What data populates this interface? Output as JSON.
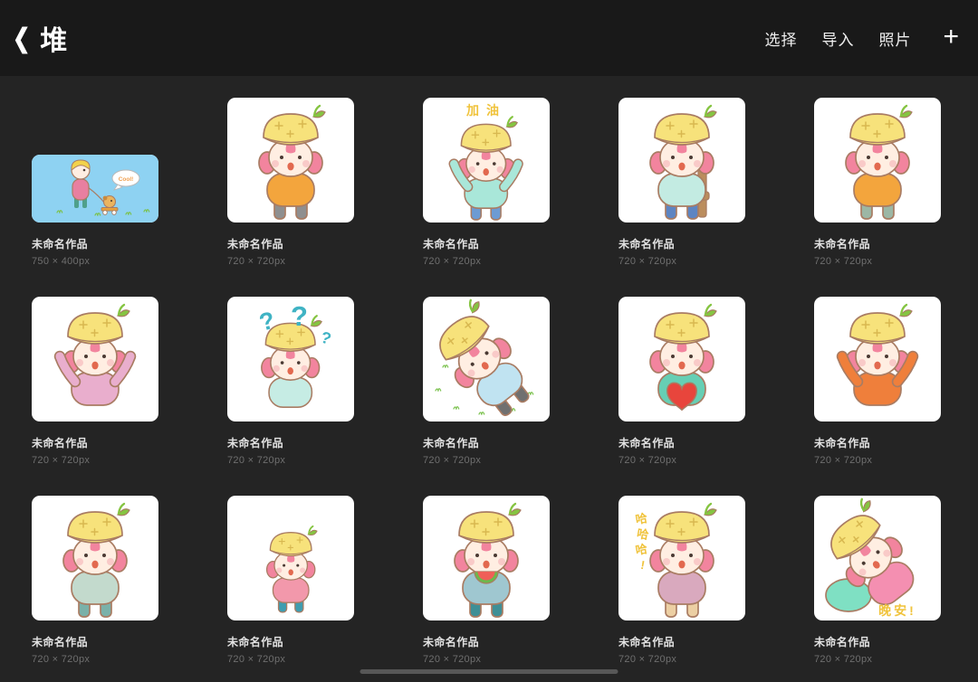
{
  "header": {
    "back_chevron": "❮",
    "title": "堆",
    "actions": [
      "选择",
      "导入",
      "照片"
    ],
    "add_label": "+"
  },
  "palette": {
    "hat": "#f7e27b",
    "hat_marks": "#d8b850",
    "leaf": "#85c441",
    "hair": "#f2849e",
    "skin": "#ffeee2",
    "outline": "#a97c63",
    "blush": "#f8c3c3",
    "mouth": "#e2694f",
    "accent_yellow": "#f0c33c",
    "qmark": "#3fb3c4",
    "heart_red": "#e8453c",
    "grass": "#7cc24f"
  },
  "artworks": [
    {
      "title": "未命名作品",
      "size": "750 × 400px",
      "type": "wide",
      "desc": "girl with yellow hair walking a puppy on a cart, blue sky background",
      "art": {
        "bg": "#8ed2f2",
        "bubble_text": "Cool!"
      }
    },
    {
      "title": "未命名作品",
      "size": "720 × 720px",
      "type": "square",
      "desc": "pineapple-hat girl with arms crossed, pouting",
      "art": {
        "pose": "stand",
        "shirt": "#f3a53d",
        "pants": "#8f8f8f"
      }
    },
    {
      "title": "未命名作品",
      "size": "720 × 720px",
      "type": "square",
      "desc": "cheering with both arms raised",
      "art": {
        "pose": "arms-up",
        "shirt": "#a9e7d9",
        "pants": "#6d9bd3",
        "accent_text": "加油",
        "accent_pos": "top"
      }
    },
    {
      "title": "未命名作品",
      "size": "720 × 720px",
      "type": "square",
      "desc": "sitting on a wooden chair in blue overalls",
      "art": {
        "pose": "stand",
        "shirt": "#c3ebe2",
        "pants": "#5d85c2",
        "chair": true
      }
    },
    {
      "title": "未命名作品",
      "size": "720 × 720px",
      "type": "square",
      "desc": "laughing loudly with head tilted back",
      "art": {
        "pose": "stand",
        "shirt": "#f3a53d",
        "pants": "#9cb7a5"
      }
    },
    {
      "title": "未命名作品",
      "size": "720 × 720px",
      "type": "square",
      "desc": "hands on head, upset, pink sweater",
      "art": {
        "pose": "arms-up",
        "shirt": "#e9aecd",
        "pants": ""
      }
    },
    {
      "title": "未命名作品",
      "size": "720 × 720px",
      "type": "square",
      "desc": "confused with teal question marks above head",
      "art": {
        "pose": "stand",
        "shirt": "#c6ece4",
        "pants": "",
        "accessory": "qmarks"
      }
    },
    {
      "title": "未命名作品",
      "size": "720 × 720px",
      "type": "square",
      "desc": "lying on the grass relaxing",
      "art": {
        "pose": "lying",
        "shirt": "#c0e3f1",
        "pants": "#707070",
        "grass": true
      }
    },
    {
      "title": "未命名作品",
      "size": "720 × 720px",
      "type": "square",
      "desc": "hugging a big red heart, teal sweater",
      "art": {
        "pose": "stand",
        "shirt": "#66cfb4",
        "pants": "",
        "accessory": "heart"
      }
    },
    {
      "title": "未命名作品",
      "size": "720 × 720px",
      "type": "square",
      "desc": "waving hello in orange apron dress",
      "art": {
        "pose": "arms-up",
        "shirt": "#ef7f3b",
        "pants": ""
      }
    },
    {
      "title": "未命名作品",
      "size": "720 × 720px",
      "type": "square",
      "desc": "standing facing forward with pigtails",
      "art": {
        "pose": "stand",
        "shirt": "#c3dacd",
        "pants": "#7ab1a9"
      }
    },
    {
      "title": "未命名作品",
      "size": "720 × 720px",
      "type": "square",
      "desc": "small shy figure glancing sideways, pink sweater",
      "art": {
        "pose": "stand",
        "shirt": "#f298ab",
        "pants": "#3f9db0",
        "small": true
      }
    },
    {
      "title": "未命名作品",
      "size": "720 × 720px",
      "type": "square",
      "desc": "eating a slice of watermelon",
      "art": {
        "pose": "stand",
        "shirt": "#9fc7d0",
        "pants": "#3e8f96",
        "accessory": "watermelon"
      }
    },
    {
      "title": "未命名作品",
      "size": "720 × 720px",
      "type": "square",
      "desc": "laughing and kicking a leg out",
      "art": {
        "pose": "stand",
        "shirt": "#d9a9be",
        "pants": "#eccfa3",
        "accent_text": "哈哈哈!",
        "accent_pos": "left"
      }
    },
    {
      "title": "未命名作品",
      "size": "720 × 720px",
      "type": "square",
      "desc": "sleeping on a mint pillow in starry pink pajamas, good night",
      "art": {
        "pose": "lying",
        "shirt": "#f48fb1",
        "pants": "",
        "accessory": "pillow",
        "accent_text": "晚安!",
        "accent_pos": "bottom"
      }
    }
  ],
  "scrollbar": {
    "present": true
  }
}
